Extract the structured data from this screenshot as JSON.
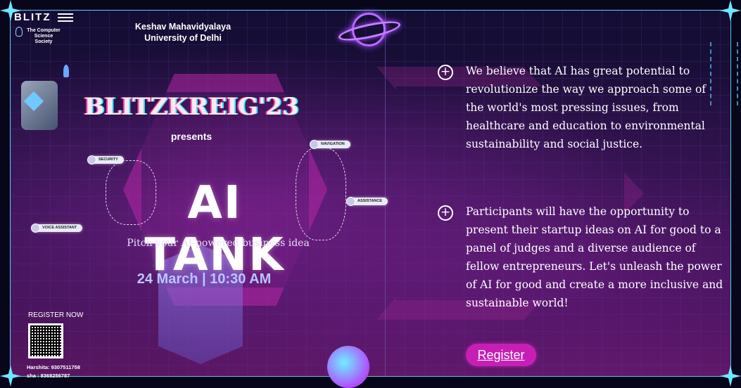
{
  "brand": {
    "logo": "BLITZ",
    "society": "The Computer Science Society"
  },
  "header": {
    "college_line1": "Keshav Mahavidyalaya",
    "college_line2": "University of Delhi"
  },
  "poster": {
    "event_title": "BLITZKREIG'23",
    "presents": "presents",
    "event_name": "AI TANK",
    "tagline": "Pitch your AI-powered business idea",
    "datetime": "24 March | 10:30 AM",
    "tags": [
      "SECURITY",
      "NAVIGATION",
      "ASSISTANCE",
      "VOICE ASSISTANT"
    ],
    "register_now": "REGISTER NOW",
    "contacts": [
      "Harshita: 9307511758",
      "sha : 8368256787"
    ]
  },
  "info": {
    "paragraph1": "We believe that AI has  great potential to revolutionize the way we approach some of the world's most pressing issues, from healthcare and education to environmental sustainability and social justice.",
    "paragraph2": "Participants will have the opportunity to present their startup ideas on AI for good to a panel of judges and a diverse audience of fellow entrepreneurs. Let's unleash the power of AI for good and create a more inclusive and sustainable world!",
    "register_label": "Register"
  },
  "colors": {
    "accent": "#c71fb5",
    "frame": "#56c8e6",
    "background": "#140d33"
  }
}
